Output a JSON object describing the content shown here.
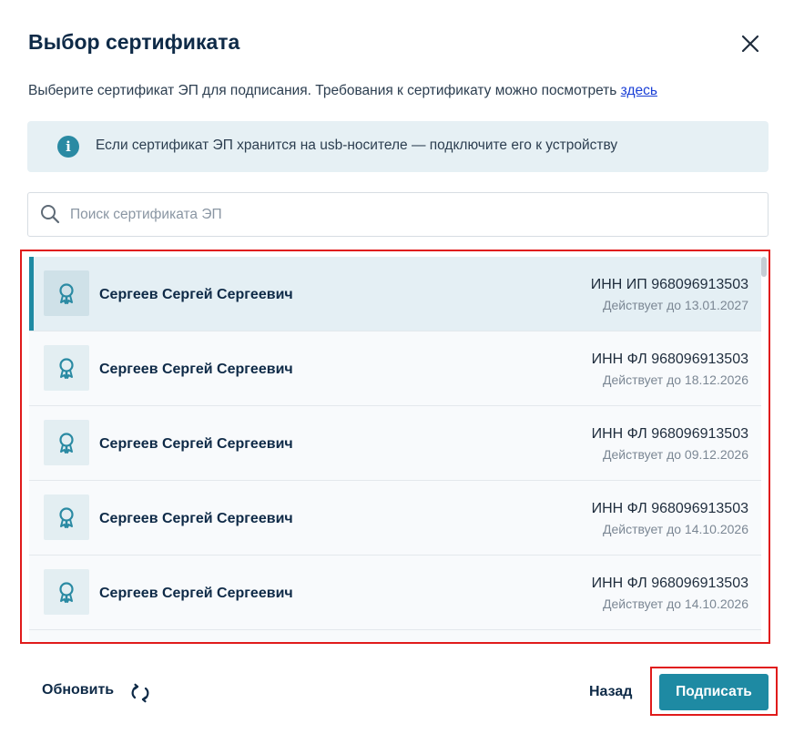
{
  "dialog": {
    "title": "Выбор сертификата",
    "subtitle_text": "Выберите сертификат ЭП для подписания. Требования к сертификату можно посмотреть ",
    "subtitle_link": "здесь"
  },
  "info": {
    "text": "Если сертификат ЭП хранится на usb-носителе — подключите его к устройству"
  },
  "search": {
    "placeholder": "Поиск сертификата ЭП"
  },
  "certificates": [
    {
      "name": "Сергеев Сергей Сергеевич",
      "inn": "ИНН ИП 968096913503",
      "valid": "Действует до 13.01.2027",
      "selected": true
    },
    {
      "name": "Сергеев Сергей Сергеевич",
      "inn": "ИНН ФЛ 968096913503",
      "valid": "Действует до 18.12.2026",
      "selected": false
    },
    {
      "name": "Сергеев Сергей Сергеевич",
      "inn": "ИНН ФЛ 968096913503",
      "valid": "Действует до 09.12.2026",
      "selected": false
    },
    {
      "name": "Сергеев Сергей Сергеевич",
      "inn": "ИНН ФЛ 968096913503",
      "valid": "Действует до 14.10.2026",
      "selected": false
    },
    {
      "name": "Сергеев Сергей Сергеевич",
      "inn": "ИНН ФЛ 968096913503",
      "valid": "Действует до 14.10.2026",
      "selected": false
    }
  ],
  "footer": {
    "refresh_label": "Обновить",
    "back_label": "Назад",
    "sign_label": "Подписать"
  },
  "colors": {
    "accent": "#1e8aa3",
    "title": "#0e2a47",
    "highlight": "#e01b1b"
  },
  "icons": {
    "close": "close-icon",
    "info": "info-icon",
    "search": "search-icon",
    "certificate": "certificate-icon",
    "refresh": "refresh-icon"
  }
}
